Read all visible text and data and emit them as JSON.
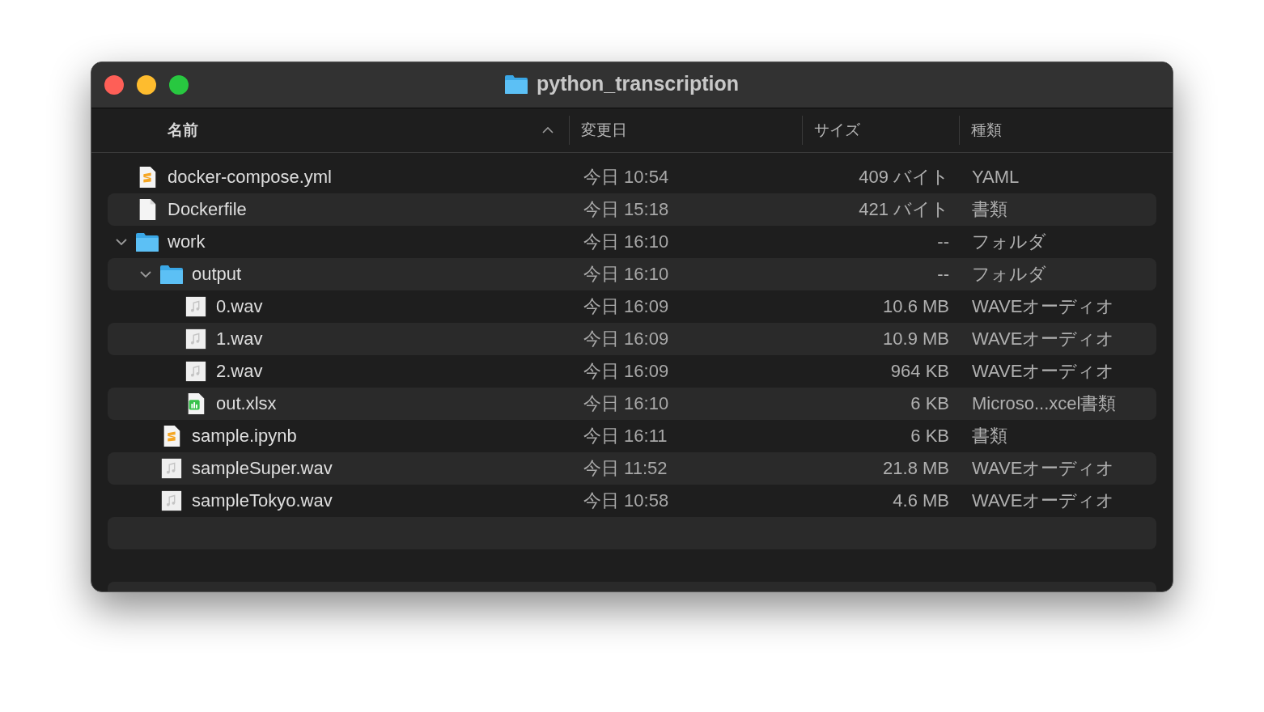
{
  "window": {
    "title": "python_transcription"
  },
  "columns": [
    {
      "label": "名前",
      "sorted": true
    },
    {
      "label": "変更日",
      "sorted": false
    },
    {
      "label": "サイズ",
      "sorted": false
    },
    {
      "label": "種類",
      "sorted": false
    }
  ],
  "files": [
    {
      "name": "docker-compose.yml",
      "kind": "yaml",
      "modified": "今日 10:54",
      "size": "409 バイト",
      "type": "YAML"
    },
    {
      "name": "Dockerfile",
      "kind": "document",
      "modified": "今日 15:18",
      "size": "421 バイト",
      "type": "書類"
    },
    {
      "name": "work",
      "kind": "folder",
      "expanded": true,
      "modified": "今日 16:10",
      "size": "--",
      "type": "フォルダ",
      "children": [
        {
          "name": "output",
          "kind": "folder",
          "expanded": true,
          "modified": "今日 16:10",
          "size": "--",
          "type": "フォルダ",
          "children": [
            {
              "name": "0.wav",
              "kind": "audio",
              "modified": "今日 16:09",
              "size": "10.6 MB",
              "type": "WAVEオーディオ"
            },
            {
              "name": "1.wav",
              "kind": "audio",
              "modified": "今日 16:09",
              "size": "10.9 MB",
              "type": "WAVEオーディオ"
            },
            {
              "name": "2.wav",
              "kind": "audio",
              "modified": "今日 16:09",
              "size": "964 KB",
              "type": "WAVEオーディオ"
            },
            {
              "name": "out.xlsx",
              "kind": "spreadsheet",
              "modified": "今日 16:10",
              "size": "6 KB",
              "type": "Microso...xcel書類"
            }
          ]
        },
        {
          "name": "sample.ipynb",
          "kind": "yaml",
          "modified": "今日 16:11",
          "size": "6 KB",
          "type": "書類"
        },
        {
          "name": "sampleSuper.wav",
          "kind": "audio",
          "modified": "今日 11:52",
          "size": "21.8 MB",
          "type": "WAVEオーディオ"
        },
        {
          "name": "sampleTokyo.wav",
          "kind": "audio",
          "modified": "今日 10:58",
          "size": "4.6 MB",
          "type": "WAVEオーディオ"
        }
      ]
    }
  ]
}
